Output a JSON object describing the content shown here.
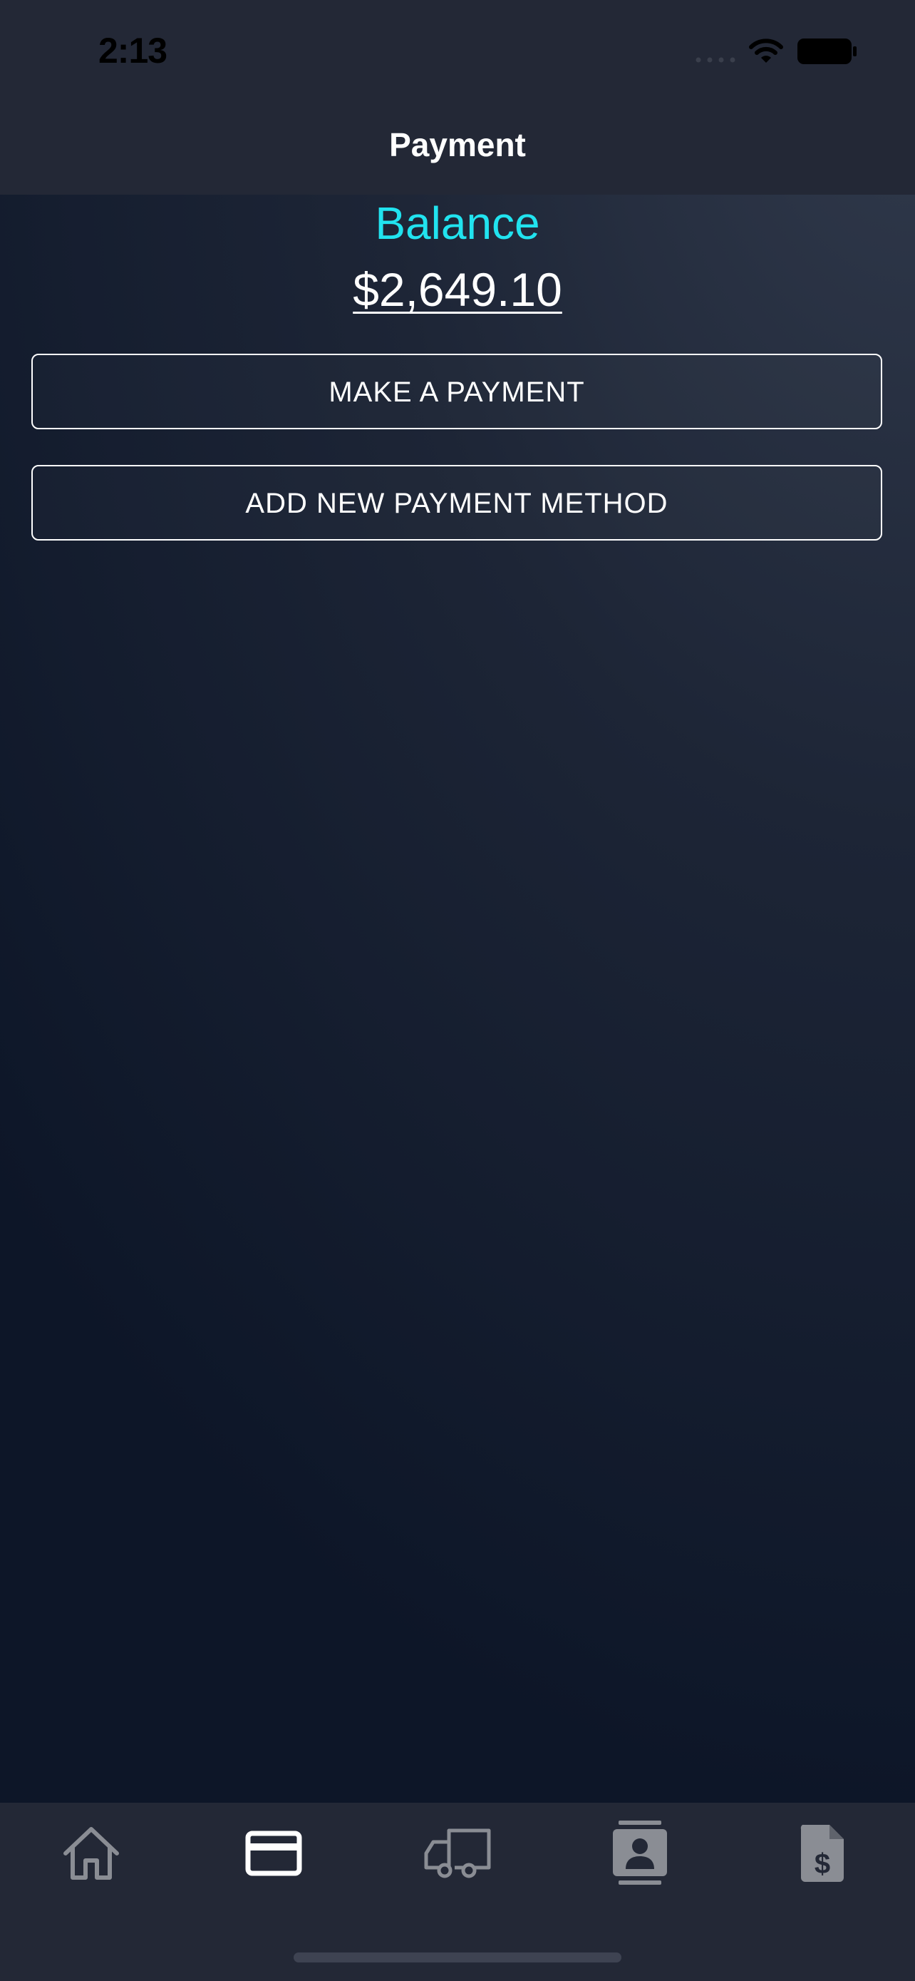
{
  "status_bar": {
    "time": "2:13"
  },
  "header": {
    "title": "Payment"
  },
  "balance": {
    "label": "Balance",
    "amount": "$2,649.10",
    "label_color": "#21e3ef"
  },
  "actions": {
    "make_payment": "MAKE A PAYMENT",
    "add_payment_method": "ADD NEW PAYMENT METHOD"
  },
  "tab_bar": {
    "active_tab": "payment",
    "tabs": [
      {
        "id": "home",
        "icon": "home-icon"
      },
      {
        "id": "payment",
        "icon": "credit-card-icon"
      },
      {
        "id": "shipping",
        "icon": "truck-icon"
      },
      {
        "id": "contacts",
        "icon": "contact-card-icon"
      },
      {
        "id": "invoices",
        "icon": "invoice-dollar-icon"
      }
    ]
  }
}
